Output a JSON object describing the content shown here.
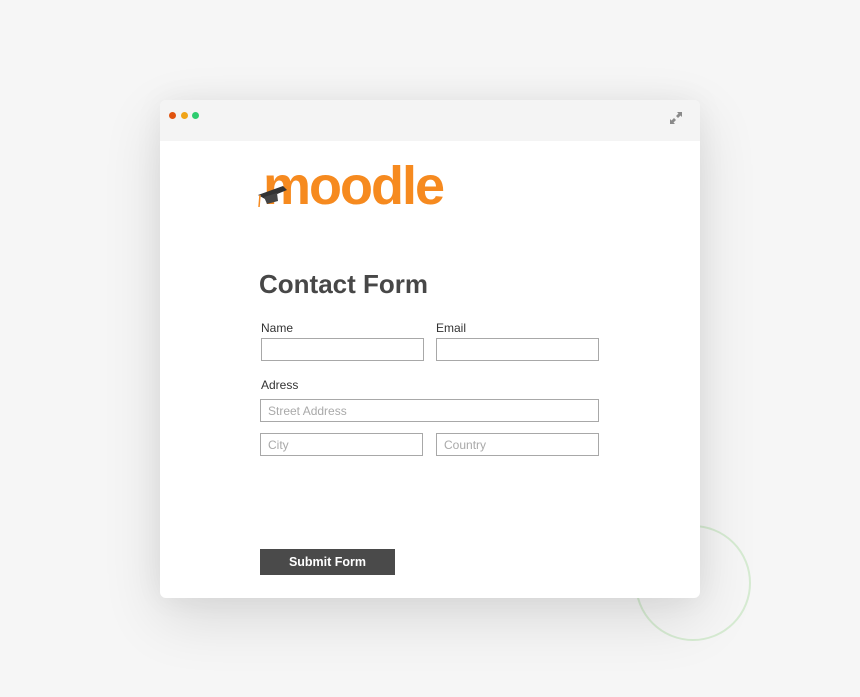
{
  "window": {
    "controls": [
      "close",
      "minimize",
      "maximize"
    ],
    "expand_icon": "expand-arrows-icon"
  },
  "logo": {
    "text": "moodle",
    "icon": "graduation-cap-icon",
    "color": "#f68a1f"
  },
  "form": {
    "title": "Contact Form",
    "name_label": "Name",
    "name_value": "",
    "email_label": "Email",
    "email_value": "",
    "address_label": "Adress",
    "street_placeholder": "Street Address",
    "city_placeholder": "City",
    "country_placeholder": "Country",
    "submit_label": "Submit Form"
  },
  "colors": {
    "accent": "#f68a1f",
    "button": "#4a4a4a",
    "dot_red": "#e0530f",
    "dot_yellow": "#f0a418",
    "dot_green": "#2dcc6f",
    "decor_circle": "#d6ebd2"
  }
}
